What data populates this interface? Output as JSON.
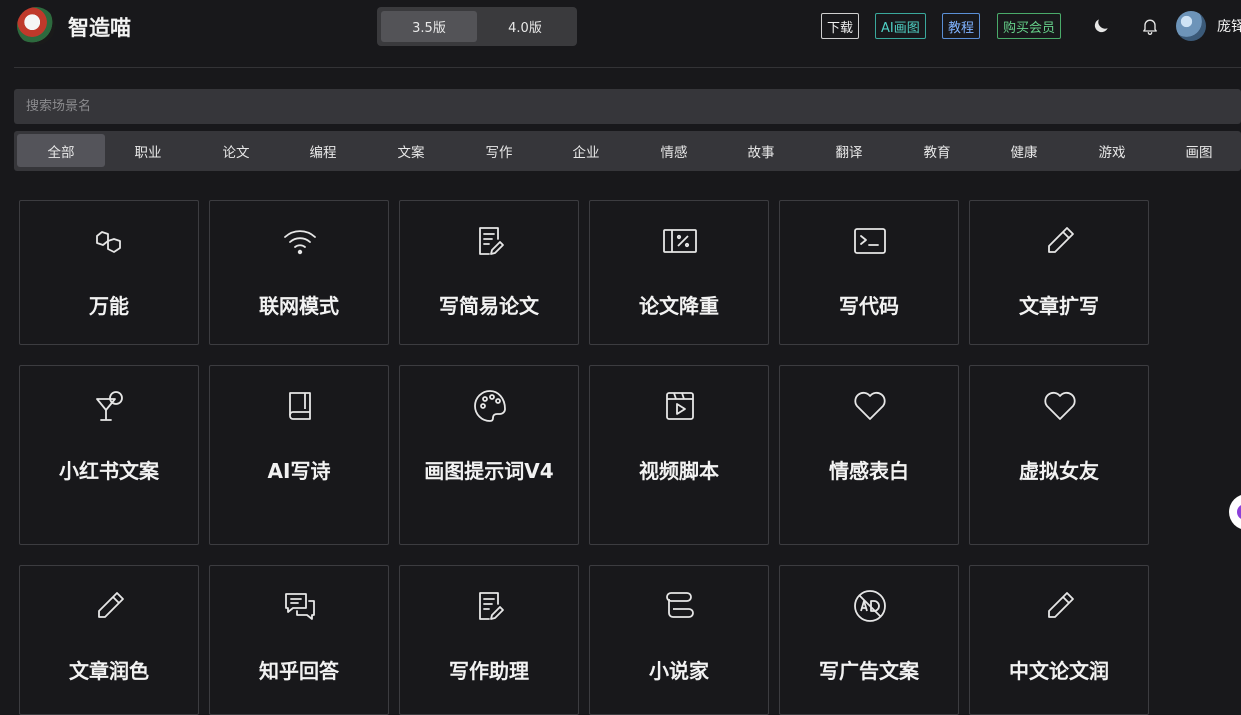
{
  "header": {
    "brand": "智造喵",
    "versions": [
      {
        "label": "3.5版",
        "active": true
      },
      {
        "label": "4.0版",
        "active": false
      }
    ],
    "buttons": [
      {
        "label": "下载",
        "style": "white"
      },
      {
        "label": "AI画图",
        "style": "teal"
      },
      {
        "label": "教程",
        "style": "blue"
      },
      {
        "label": "购买会员",
        "style": "green"
      }
    ],
    "icons": [
      "moon-icon",
      "bell-icon"
    ],
    "username": "庞铎"
  },
  "search": {
    "placeholder": "搜索场景名",
    "value": ""
  },
  "categories": [
    {
      "label": "全部",
      "active": true
    },
    {
      "label": "职业"
    },
    {
      "label": "论文"
    },
    {
      "label": "编程"
    },
    {
      "label": "文案"
    },
    {
      "label": "写作"
    },
    {
      "label": "企业"
    },
    {
      "label": "情感"
    },
    {
      "label": "故事"
    },
    {
      "label": "翻译"
    },
    {
      "label": "教育"
    },
    {
      "label": "健康"
    },
    {
      "label": "游戏"
    },
    {
      "label": "画图"
    }
  ],
  "cards": [
    {
      "label": "万能",
      "icon": "polygon-link-icon"
    },
    {
      "label": "联网模式",
      "icon": "wifi-icon"
    },
    {
      "label": "写简易论文",
      "icon": "document-edit-icon"
    },
    {
      "label": "论文降重",
      "icon": "percent-box-icon"
    },
    {
      "label": "写代码",
      "icon": "terminal-icon"
    },
    {
      "label": "文章扩写",
      "icon": "pencil-icon"
    },
    {
      "label": "小红书文案",
      "icon": "cocktail-icon"
    },
    {
      "label": "AI写诗",
      "icon": "book-icon"
    },
    {
      "label": "画图提示词V4",
      "icon": "palette-icon"
    },
    {
      "label": "视频脚本",
      "icon": "video-icon"
    },
    {
      "label": "情感表白",
      "icon": "heart-icon"
    },
    {
      "label": "虚拟女友",
      "icon": "heart-icon"
    },
    {
      "label": "文章润色",
      "icon": "pencil-icon"
    },
    {
      "label": "知乎回答",
      "icon": "chat-icon"
    },
    {
      "label": "写作助理",
      "icon": "document-edit-icon"
    },
    {
      "label": "小说家",
      "icon": "scroll-icon"
    },
    {
      "label": "写广告文案",
      "icon": "ad-icon"
    },
    {
      "label": "中文论文润",
      "icon": "pencil-icon"
    }
  ]
}
